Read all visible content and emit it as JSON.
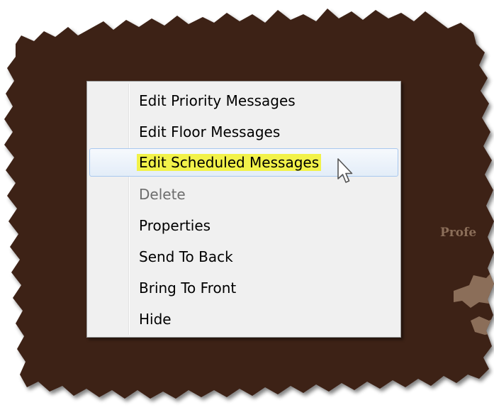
{
  "menu": {
    "items": [
      {
        "label": "Edit Priority Messages",
        "enabled": true,
        "hovered": false
      },
      {
        "label": "Edit Floor Messages",
        "enabled": true,
        "hovered": false
      },
      {
        "label": "Edit Scheduled Messages",
        "enabled": true,
        "hovered": true,
        "highlighted": true
      },
      {
        "label": "Delete",
        "enabled": false,
        "hovered": false
      },
      {
        "label": "Properties",
        "enabled": true,
        "hovered": false
      },
      {
        "label": "Send To Back",
        "enabled": true,
        "hovered": false
      },
      {
        "label": "Bring To Front",
        "enabled": true,
        "hovered": false
      },
      {
        "label": "Hide",
        "enabled": true,
        "hovered": false
      }
    ]
  },
  "background": {
    "partial_text": "Profe"
  },
  "colors": {
    "backdrop": "#3d2319",
    "menu_background": "#f0f0f0",
    "hover_border": "#a8c8ef",
    "text_highlight": "#f2f24a",
    "disabled_text": "#6d6d6d",
    "side_text": "#8b6e59"
  },
  "icons": {
    "cursor": "arrow-cursor-icon"
  }
}
